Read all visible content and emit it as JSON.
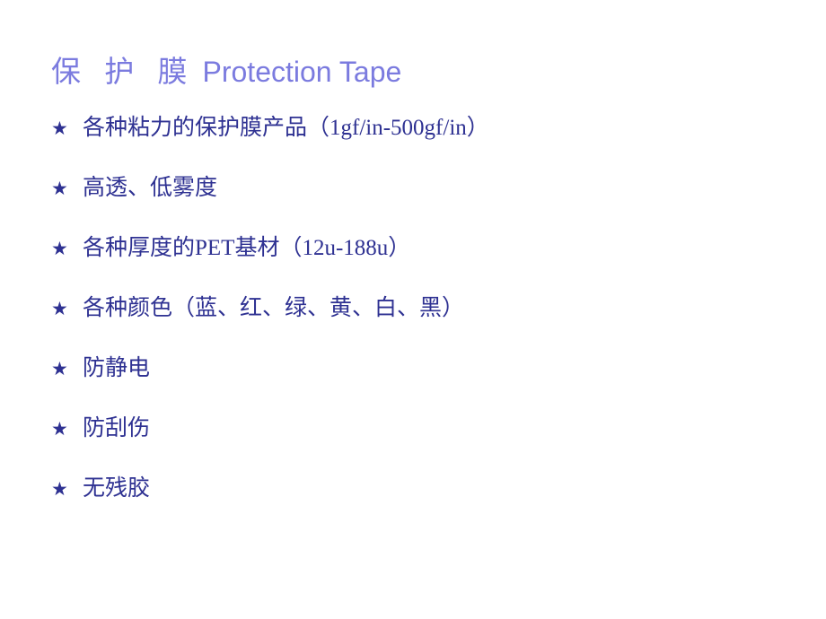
{
  "slide": {
    "title": {
      "chinese": "保 护 膜",
      "english": "Protection Tape",
      "color": "#7B7BDF"
    },
    "bullet_marker": "★",
    "text_color": "#2E3192",
    "background_color": "#FFFFFF",
    "bullets": [
      {
        "marker": "★",
        "text": "各种粘力的保护膜产品（1gf/in-500gf/in）"
      },
      {
        "marker": "★",
        "text": "高透、低雾度"
      },
      {
        "marker": "★",
        "text": "各种厚度的PET基材（12u-188u）"
      },
      {
        "marker": "★",
        "text": "各种颜色（蓝、红、绿、黄、白、黑）"
      },
      {
        "marker": "★",
        "text": "防静电"
      },
      {
        "marker": "★",
        "text": "防刮伤"
      },
      {
        "marker": "★",
        "text": "无残胶"
      }
    ]
  }
}
